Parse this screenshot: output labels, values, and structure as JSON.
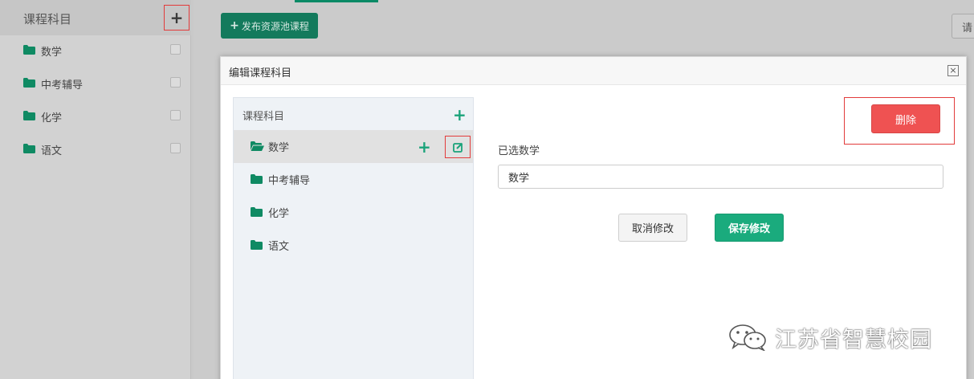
{
  "sidebar": {
    "title": "课程科目",
    "add_icon": "plus-icon",
    "items": [
      {
        "label": "数学",
        "icon": "folder-icon"
      },
      {
        "label": "中考辅导",
        "icon": "folder-icon"
      },
      {
        "label": "化学",
        "icon": "folder-icon"
      },
      {
        "label": "语文",
        "icon": "folder-icon"
      }
    ]
  },
  "toolbar": {
    "publish_label": "发布资源池课程",
    "publish_icon": "plus-icon",
    "request_label": "请"
  },
  "modal": {
    "title": "编辑课程科目",
    "close_icon": "close-icon",
    "tree": {
      "title": "课程科目",
      "items": [
        {
          "label": "数学",
          "icon": "folder-open-icon",
          "selected": true
        },
        {
          "label": "中考辅导",
          "icon": "folder-icon"
        },
        {
          "label": "化学",
          "icon": "folder-icon"
        },
        {
          "label": "语文",
          "icon": "folder-icon"
        }
      ]
    },
    "delete_label": "删除",
    "selected_label": "已选数学",
    "selected_value": "数学",
    "cancel_label": "取消修改",
    "save_label": "保存修改"
  },
  "watermark": {
    "text": "江苏省智慧校园",
    "icon": "wechat-icon"
  },
  "colors": {
    "accent_green": "#1aab7d",
    "delete_red": "#ef5252",
    "highlight_red": "#e23b3b",
    "folder_green": "#0f8a63"
  }
}
